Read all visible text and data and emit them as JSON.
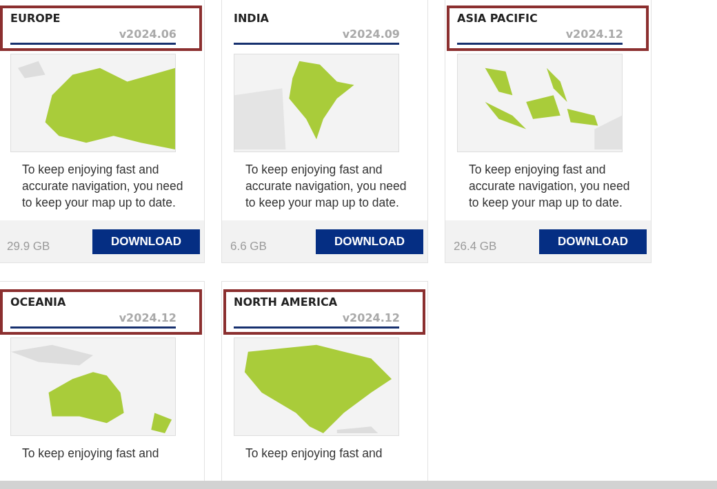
{
  "regions": [
    {
      "title": "EUROPE",
      "version": "v2024.06",
      "highlighted": true,
      "description": "To keep enjoying fast and accurate navigation, you need to keep your map up to date.",
      "size": "29.9 GB",
      "button": "DOWNLOAD"
    },
    {
      "title": "INDIA",
      "version": "v2024.09",
      "highlighted": false,
      "description": "To keep enjoying fast and accurate navigation, you need to keep your map up to date.",
      "size": "6.6 GB",
      "button": "DOWNLOAD"
    },
    {
      "title": "ASIA PACIFIC",
      "version": "v2024.12",
      "highlighted": true,
      "description": "To keep enjoying fast and accurate navigation, you need to keep your map up to date.",
      "size": "26.4 GB",
      "button": "DOWNLOAD"
    },
    {
      "title": "OCEANIA",
      "version": "v2024.12",
      "highlighted": true,
      "description": "To keep enjoying fast and"
    },
    {
      "title": "NORTH AMERICA",
      "version": "v2024.12",
      "highlighted": true,
      "description": "To keep enjoying fast and"
    }
  ]
}
